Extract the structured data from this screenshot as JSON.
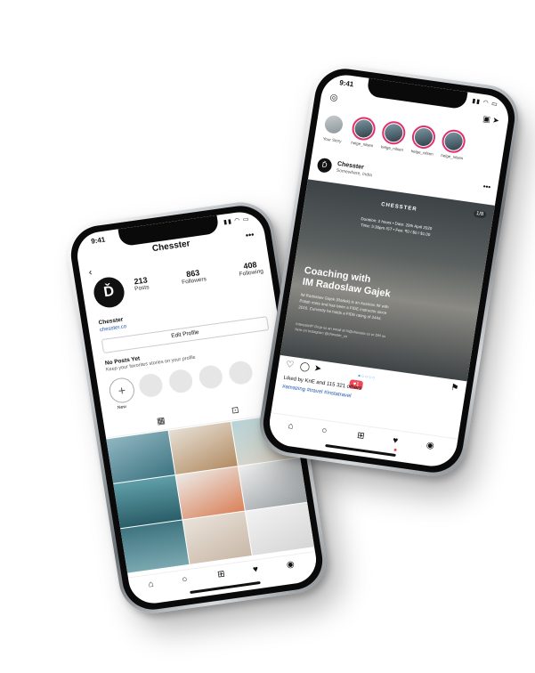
{
  "profile_phone": {
    "status_time": "9:41",
    "header_title": "Chesster",
    "back_icon": "chevron-left-icon",
    "more_icon": "more-dots-icon",
    "avatar_glyph": "Ď",
    "stats": [
      {
        "value": "213",
        "label": "Posts"
      },
      {
        "value": "863",
        "label": "Followers"
      },
      {
        "value": "408",
        "label": "Following"
      }
    ],
    "name": "Chesster",
    "link": "chesster.co",
    "edit_profile_label": "Edit Profile",
    "no_posts_title": "No Posts Yet",
    "no_posts_subtitle": "Keep your favorites stories on your profile",
    "new_highlight_label": "New",
    "tabs": [
      "grid-icon",
      "tagged-icon"
    ],
    "nav_icons": [
      "home-icon",
      "search-icon",
      "add-post-icon",
      "heart-icon",
      "profile-avatar-icon"
    ]
  },
  "feed_phone": {
    "status_time": "9:41",
    "camera_icon": "camera-icon",
    "right_icons": [
      "igtv-icon",
      "direct-send-icon"
    ],
    "stories": [
      {
        "name": "Your Story",
        "own": true
      },
      {
        "name": "helge_nilsen",
        "own": false
      },
      {
        "name": "helge_nilsen",
        "own": false
      },
      {
        "name": "helge_nilsen",
        "own": false
      },
      {
        "name": "helge_nilsen",
        "own": false
      }
    ],
    "post": {
      "username": "Chesster",
      "location": "Somewhere, India",
      "counter": "1/8",
      "brand": "CHESSTER",
      "meta_line1": "Duration: 2 hours • Date: 20th April 2020",
      "meta_line2": "Time: 5:30pm IST • Fee: ₹0 / $0 / $1.00",
      "headline_line1": "Coaching with",
      "headline_line2": "IM Radoslaw Gajek",
      "description": "IM Radoslaw Gajek (Radek) is an Austrian IM with Polish roots and has been a FIDE instructor since 2016. Currently he holds a FIDE rating of 2444.",
      "description2": "Interested? Drop us an email at hi@chesster.co or DM us here on Instagram @chesster_co",
      "likes_text": "Liked by KnE and 115 321 others",
      "tags_text": "#amazing #travel #instatravel",
      "notif_badge": "♥1"
    },
    "action_icons": [
      "heart-outline-icon",
      "comment-icon",
      "share-icon",
      "bookmark-icon"
    ],
    "pager_dots": "●○○○○",
    "nav_icons": [
      "home-icon",
      "search-icon",
      "add-post-icon",
      "heart-filled-icon",
      "profile-avatar-icon"
    ]
  }
}
